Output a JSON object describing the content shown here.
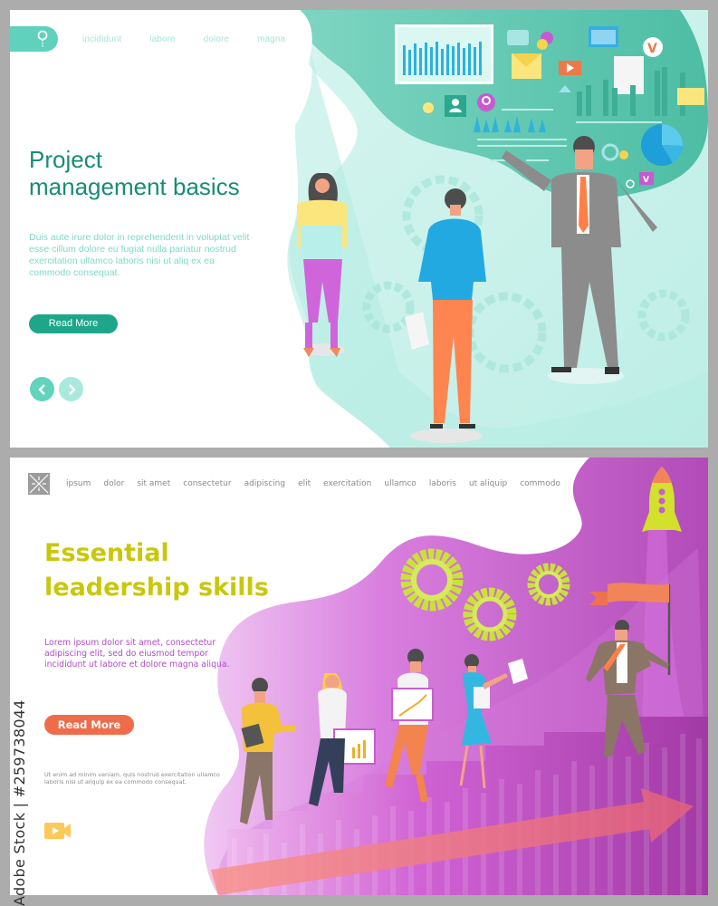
{
  "top_panel": {
    "nav": {
      "search_icon": "search-pin-icon",
      "links": [
        "incididunt",
        "labore",
        "dolore",
        "magna"
      ]
    },
    "title": "Project management basics",
    "title_lines": [
      "Project",
      "management basics"
    ],
    "body": "Duis aute irure dolor in reprehenderit in voluptat velit esse cillum dolore eu fugiat nulla pariatur nostrud exercitation ullamco laboris nisi ut aliq ex ea  commodo consequat.",
    "read_more": "Read More",
    "prev_icon": "chevron-left-icon",
    "next_icon": "chevron-right-icon",
    "colors": {
      "accent": "#1ea68a",
      "title": "#168c77",
      "body": "#7fd9c6",
      "nav_link": "#a5e6da",
      "blob_dark": "#5cc7b0",
      "blob_light": "#c5f0ea"
    }
  },
  "bottom_panel": {
    "nav": {
      "menu_icon": "menu-burst-icon",
      "links": [
        "ipsum",
        "dolor",
        "sit amet",
        "consectetur",
        "adipiscing",
        "elit",
        "exercitation",
        "ullamco",
        "laboris",
        "ut aliquip",
        "commodo"
      ]
    },
    "title_lines": [
      "Essential",
      "leadership skills"
    ],
    "body": "Lorem ipsum dolor sit amet, consectetur adipiscing elit, sed do eiusmod tempor incididunt ut labore et dolore magna aliqua.",
    "read_more": "Read More",
    "small_text": "Ut enim ad minim veniam, quis nostrud exercitation ullamco laboris nisi ut aliquip ex ea commodo consequat.",
    "video_icon": "video-camera-icon",
    "colors": {
      "title": "#c9c70d",
      "body": "#b04dc6",
      "button": "#ef6c4a",
      "blob_purple": "#c55fcf",
      "gear": "#cbe03a",
      "arrow": "#f0706a"
    }
  },
  "watermark": {
    "text": "Adobe Stock | #259738044"
  }
}
